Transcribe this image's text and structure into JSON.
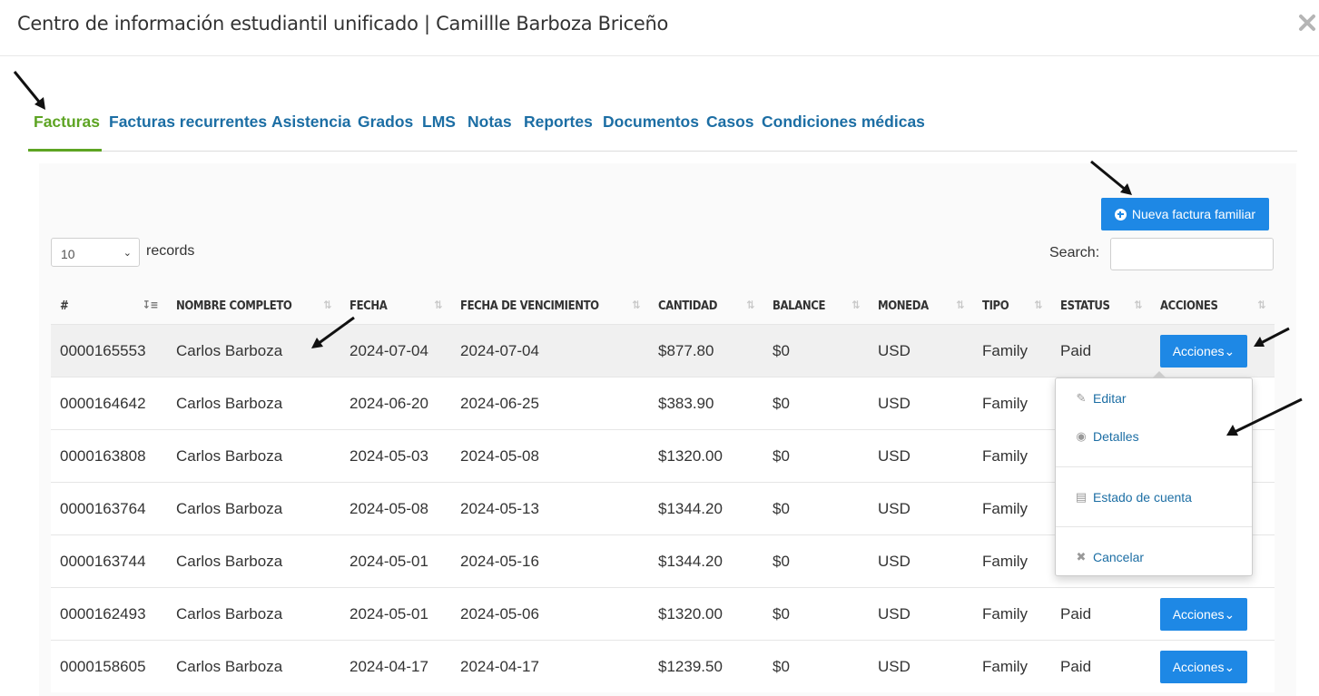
{
  "modal": {
    "title": "Centro de información estudiantil unificado | Camillle Barboza Briceño",
    "close_icon": "close-icon"
  },
  "tabs": [
    {
      "label": "Facturas",
      "active": true
    },
    {
      "label": "Facturas recurrentes"
    },
    {
      "label": "Asistencia"
    },
    {
      "label": "Grados"
    },
    {
      "label": "LMS"
    },
    {
      "label": "Notas"
    },
    {
      "label": "Reportes"
    },
    {
      "label": "Documentos"
    },
    {
      "label": "Casos"
    },
    {
      "label": "Condiciones médicas"
    }
  ],
  "toolbar": {
    "new_invoice_label": "Nueva factura familiar",
    "page_length_value": "10",
    "records_label": "records",
    "search_label": "Search:",
    "search_value": ""
  },
  "table": {
    "columns": [
      "#",
      "NOMBRE COMPLETO",
      "FECHA",
      "FECHA DE VENCIMIENTO",
      "CANTIDAD",
      "BALANCE",
      "MONEDA",
      "TIPO",
      "ESTATUS",
      "ACCIONES"
    ],
    "sorted_column": "#",
    "action_label": "Acciones",
    "rows": [
      {
        "id": "0000165553",
        "name": "Carlos Barboza",
        "date": "2024-07-04",
        "due": "2024-07-04",
        "amount": "$877.80",
        "balance": "$0",
        "currency": "USD",
        "type": "Family",
        "status": "Paid"
      },
      {
        "id": "0000164642",
        "name": "Carlos Barboza",
        "date": "2024-06-20",
        "due": "2024-06-25",
        "amount": "$383.90",
        "balance": "$0",
        "currency": "USD",
        "type": "Family",
        "status": ""
      },
      {
        "id": "0000163808",
        "name": "Carlos Barboza",
        "date": "2024-05-03",
        "due": "2024-05-08",
        "amount": "$1320.00",
        "balance": "$0",
        "currency": "USD",
        "type": "Family",
        "status": ""
      },
      {
        "id": "0000163764",
        "name": "Carlos Barboza",
        "date": "2024-05-08",
        "due": "2024-05-13",
        "amount": "$1344.20",
        "balance": "$0",
        "currency": "USD",
        "type": "Family",
        "status": ""
      },
      {
        "id": "0000163744",
        "name": "Carlos Barboza",
        "date": "2024-05-01",
        "due": "2024-05-16",
        "amount": "$1344.20",
        "balance": "$0",
        "currency": "USD",
        "type": "Family",
        "status": ""
      },
      {
        "id": "0000162493",
        "name": "Carlos Barboza",
        "date": "2024-05-01",
        "due": "2024-05-06",
        "amount": "$1320.00",
        "balance": "$0",
        "currency": "USD",
        "type": "Family",
        "status": "Paid"
      },
      {
        "id": "0000158605",
        "name": "Carlos Barboza",
        "date": "2024-04-17",
        "due": "2024-04-17",
        "amount": "$1239.50",
        "balance": "$0",
        "currency": "USD",
        "type": "Family",
        "status": "Paid"
      }
    ]
  },
  "dropdown": {
    "items": [
      {
        "label": "Editar",
        "icon": "edit-icon"
      },
      {
        "label": "Detalles",
        "icon": "eye-icon"
      },
      {
        "label": "Estado de cuenta",
        "icon": "document-icon"
      },
      {
        "label": "Cancelar",
        "icon": "close-icon"
      }
    ]
  },
  "colors": {
    "accent_green": "#5da423",
    "link_blue": "#1c6ea4",
    "button_blue": "#1e88e5"
  }
}
